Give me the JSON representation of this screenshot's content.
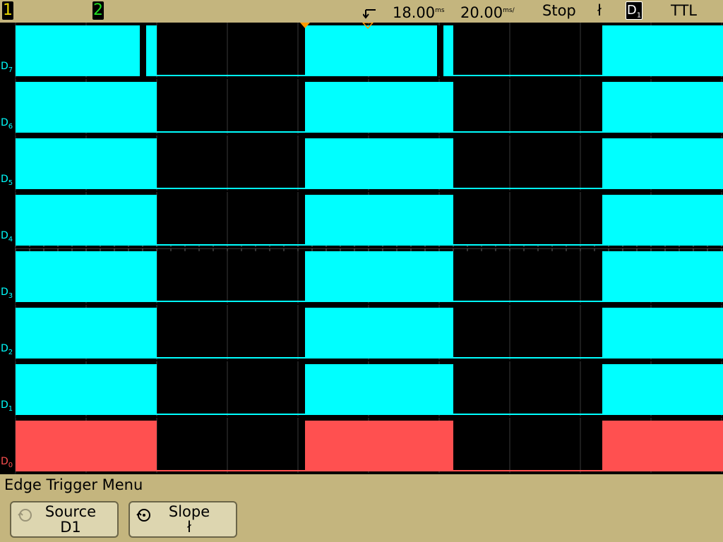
{
  "status_bar": {
    "channel1": "1",
    "channel2": "2",
    "trigger_delay": "18.00",
    "trigger_delay_unit": "ms",
    "time_per_div": "20.00",
    "time_per_div_unit": "ms/",
    "run_state": "Stop",
    "trigger_slope_symbol": "ł",
    "trigger_source": "D",
    "trigger_source_sub": "1",
    "threshold": "TTL"
  },
  "channels": [
    {
      "label": "D",
      "index": "7",
      "color": "#00ffff"
    },
    {
      "label": "D",
      "index": "6",
      "color": "#00ffff"
    },
    {
      "label": "D",
      "index": "5",
      "color": "#00ffff"
    },
    {
      "label": "D",
      "index": "4",
      "color": "#00ffff"
    },
    {
      "label": "D",
      "index": "3",
      "color": "#00ffff"
    },
    {
      "label": "D",
      "index": "2",
      "color": "#00ffff"
    },
    {
      "label": "D",
      "index": "1",
      "color": "#00ffff"
    },
    {
      "label": "D",
      "index": "0",
      "color": "#ff5050"
    }
  ],
  "menu": {
    "title": "Edge Trigger Menu",
    "softkeys": [
      {
        "label": "Source",
        "value": "D1"
      },
      {
        "label": "Slope",
        "value": "ł"
      }
    ]
  },
  "colors": {
    "background": "#c4b57e",
    "screen": "#000000",
    "digital": "#00ffff",
    "d0": "#ff5050",
    "grid": "#3a3a3a",
    "trigger_marker": "#ff9a00"
  }
}
